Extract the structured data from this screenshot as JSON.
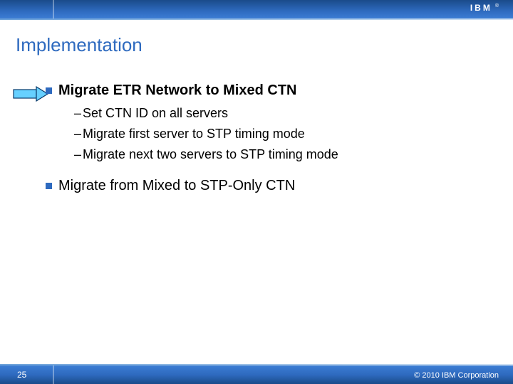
{
  "brand": {
    "name": "IBM",
    "registered": "®"
  },
  "title": "Implementation",
  "bullets": [
    {
      "text": "Migrate ETR Network to Mixed CTN",
      "highlighted": true,
      "subitems": [
        "Set CTN ID on all servers",
        "Migrate first server to STP timing mode",
        "Migrate next two servers to STP timing mode"
      ]
    },
    {
      "text": "Migrate from Mixed to STP-Only CTN",
      "highlighted": false,
      "subitems": []
    }
  ],
  "footer": {
    "page": "25",
    "copyright": "© 2010 IBM Corporation"
  }
}
